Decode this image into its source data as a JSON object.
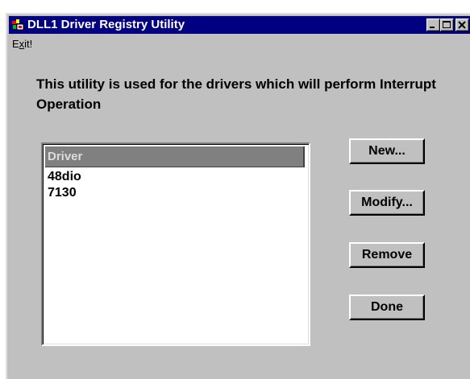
{
  "window": {
    "title": "DLL1 Driver Registry Utility",
    "controls": [
      "minimize-icon",
      "maximize-icon",
      "close-icon"
    ]
  },
  "menu": {
    "exit_label": "Exit!"
  },
  "description": "This utility is used for the drivers which will perform Interrupt Operation",
  "list": {
    "header": "Driver",
    "items": [
      "48dio",
      "7130"
    ]
  },
  "buttons": {
    "new_label": "New...",
    "modify_label": "Modify...",
    "remove_label": "Remove",
    "done_label": "Done"
  },
  "colors": {
    "titlebar": "#000080",
    "face": "#c0c0c0",
    "list_header": "#808080"
  }
}
